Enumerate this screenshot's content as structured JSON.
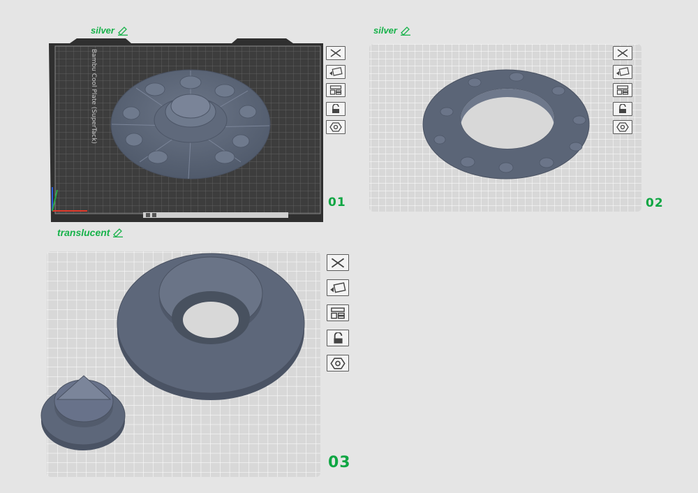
{
  "plates": [
    {
      "label": "silver",
      "number": "01",
      "bed_text": "Bambu Cool Plate (SuperTack)"
    },
    {
      "label": "silver",
      "number": "02"
    },
    {
      "label": "translucent",
      "number": "03"
    }
  ],
  "toolbar_icons": [
    "close-icon",
    "orient-icon",
    "arrange-icon",
    "lock-icon",
    "settings-icon"
  ],
  "colors": {
    "background": "#e5e5e5",
    "label_green": "#17b24a",
    "model": "#5b6577",
    "grid_light": "#ffffff",
    "bed_light": "#d8d8d8",
    "bed_dark": "#3a3a3a"
  }
}
